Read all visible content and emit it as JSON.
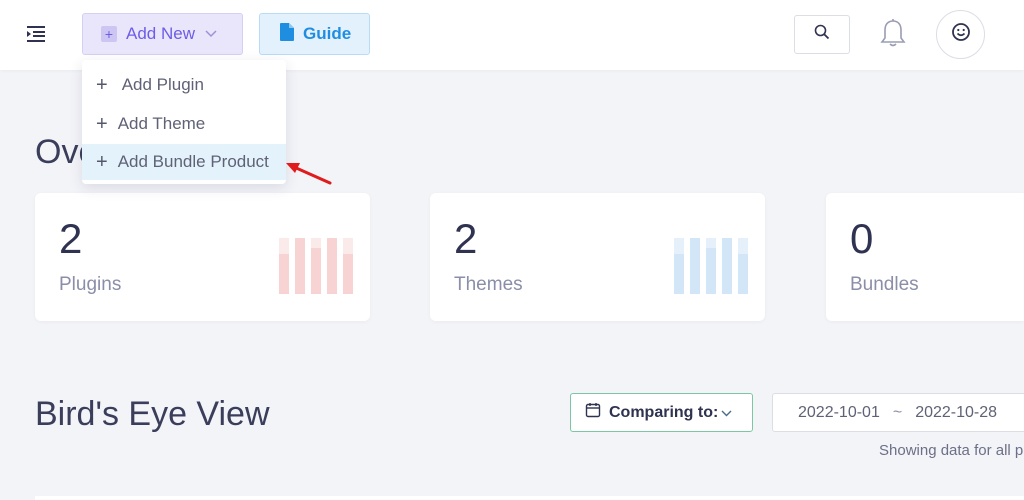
{
  "topbar": {
    "add_new_label": "Add New",
    "guide_label": "Guide"
  },
  "add_new_menu": {
    "items": [
      {
        "label": "Add Plugin"
      },
      {
        "label": "Add Theme"
      },
      {
        "label": "Add Bundle Product"
      }
    ]
  },
  "overview": {
    "title_visible": "Ove",
    "cards": [
      {
        "count": "2",
        "label": "Plugins"
      },
      {
        "count": "2",
        "label": "Themes"
      },
      {
        "count": "0",
        "label": "Bundles"
      }
    ]
  },
  "birds_eye": {
    "title": "Bird's Eye View",
    "compare_label": "Comparing to:",
    "date_start": "2022-10-01",
    "date_sep": "~",
    "date_end": "2022-10-28",
    "showing_text": "Showing data for all p"
  },
  "colors": {
    "accent_purple": "#6c5ce7",
    "guide_blue": "#1f8ee0",
    "highlight": "#e4f3fb",
    "annotation_arrow": "#e01b1b",
    "compare_border": "#7cc6a4"
  },
  "icons": {
    "menu": "menu-collapse-icon",
    "add": "plus-square-icon",
    "guide": "document-icon",
    "search": "search-icon",
    "notifications": "bell-icon",
    "avatar": "smiley-face-icon",
    "calendar": "calendar-icon"
  }
}
